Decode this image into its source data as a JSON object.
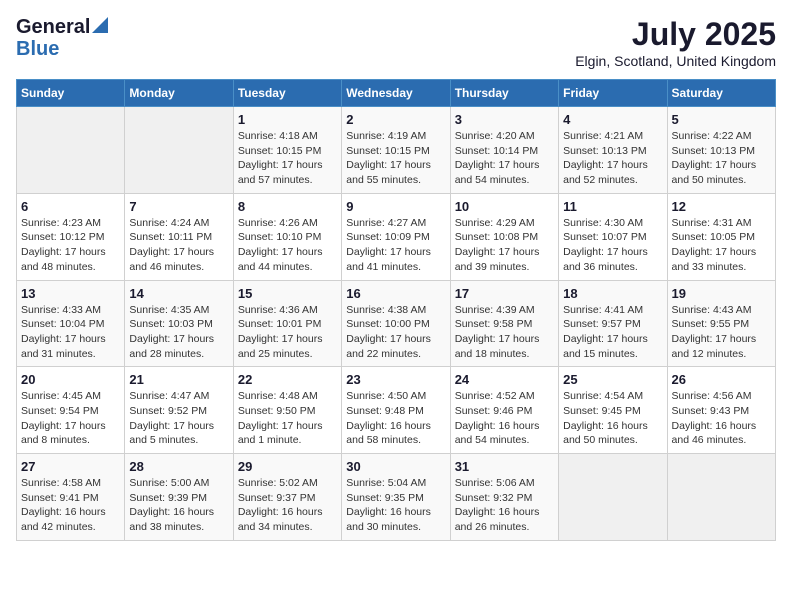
{
  "logo": {
    "general": "General",
    "blue": "Blue"
  },
  "title": "July 2025",
  "subtitle": "Elgin, Scotland, United Kingdom",
  "days_of_week": [
    "Sunday",
    "Monday",
    "Tuesday",
    "Wednesday",
    "Thursday",
    "Friday",
    "Saturday"
  ],
  "weeks": [
    [
      {
        "day": "",
        "info": ""
      },
      {
        "day": "",
        "info": ""
      },
      {
        "day": "1",
        "info": "Sunrise: 4:18 AM\nSunset: 10:15 PM\nDaylight: 17 hours and 57 minutes."
      },
      {
        "day": "2",
        "info": "Sunrise: 4:19 AM\nSunset: 10:15 PM\nDaylight: 17 hours and 55 minutes."
      },
      {
        "day": "3",
        "info": "Sunrise: 4:20 AM\nSunset: 10:14 PM\nDaylight: 17 hours and 54 minutes."
      },
      {
        "day": "4",
        "info": "Sunrise: 4:21 AM\nSunset: 10:13 PM\nDaylight: 17 hours and 52 minutes."
      },
      {
        "day": "5",
        "info": "Sunrise: 4:22 AM\nSunset: 10:13 PM\nDaylight: 17 hours and 50 minutes."
      }
    ],
    [
      {
        "day": "6",
        "info": "Sunrise: 4:23 AM\nSunset: 10:12 PM\nDaylight: 17 hours and 48 minutes."
      },
      {
        "day": "7",
        "info": "Sunrise: 4:24 AM\nSunset: 10:11 PM\nDaylight: 17 hours and 46 minutes."
      },
      {
        "day": "8",
        "info": "Sunrise: 4:26 AM\nSunset: 10:10 PM\nDaylight: 17 hours and 44 minutes."
      },
      {
        "day": "9",
        "info": "Sunrise: 4:27 AM\nSunset: 10:09 PM\nDaylight: 17 hours and 41 minutes."
      },
      {
        "day": "10",
        "info": "Sunrise: 4:29 AM\nSunset: 10:08 PM\nDaylight: 17 hours and 39 minutes."
      },
      {
        "day": "11",
        "info": "Sunrise: 4:30 AM\nSunset: 10:07 PM\nDaylight: 17 hours and 36 minutes."
      },
      {
        "day": "12",
        "info": "Sunrise: 4:31 AM\nSunset: 10:05 PM\nDaylight: 17 hours and 33 minutes."
      }
    ],
    [
      {
        "day": "13",
        "info": "Sunrise: 4:33 AM\nSunset: 10:04 PM\nDaylight: 17 hours and 31 minutes."
      },
      {
        "day": "14",
        "info": "Sunrise: 4:35 AM\nSunset: 10:03 PM\nDaylight: 17 hours and 28 minutes."
      },
      {
        "day": "15",
        "info": "Sunrise: 4:36 AM\nSunset: 10:01 PM\nDaylight: 17 hours and 25 minutes."
      },
      {
        "day": "16",
        "info": "Sunrise: 4:38 AM\nSunset: 10:00 PM\nDaylight: 17 hours and 22 minutes."
      },
      {
        "day": "17",
        "info": "Sunrise: 4:39 AM\nSunset: 9:58 PM\nDaylight: 17 hours and 18 minutes."
      },
      {
        "day": "18",
        "info": "Sunrise: 4:41 AM\nSunset: 9:57 PM\nDaylight: 17 hours and 15 minutes."
      },
      {
        "day": "19",
        "info": "Sunrise: 4:43 AM\nSunset: 9:55 PM\nDaylight: 17 hours and 12 minutes."
      }
    ],
    [
      {
        "day": "20",
        "info": "Sunrise: 4:45 AM\nSunset: 9:54 PM\nDaylight: 17 hours and 8 minutes."
      },
      {
        "day": "21",
        "info": "Sunrise: 4:47 AM\nSunset: 9:52 PM\nDaylight: 17 hours and 5 minutes."
      },
      {
        "day": "22",
        "info": "Sunrise: 4:48 AM\nSunset: 9:50 PM\nDaylight: 17 hours and 1 minute."
      },
      {
        "day": "23",
        "info": "Sunrise: 4:50 AM\nSunset: 9:48 PM\nDaylight: 16 hours and 58 minutes."
      },
      {
        "day": "24",
        "info": "Sunrise: 4:52 AM\nSunset: 9:46 PM\nDaylight: 16 hours and 54 minutes."
      },
      {
        "day": "25",
        "info": "Sunrise: 4:54 AM\nSunset: 9:45 PM\nDaylight: 16 hours and 50 minutes."
      },
      {
        "day": "26",
        "info": "Sunrise: 4:56 AM\nSunset: 9:43 PM\nDaylight: 16 hours and 46 minutes."
      }
    ],
    [
      {
        "day": "27",
        "info": "Sunrise: 4:58 AM\nSunset: 9:41 PM\nDaylight: 16 hours and 42 minutes."
      },
      {
        "day": "28",
        "info": "Sunrise: 5:00 AM\nSunset: 9:39 PM\nDaylight: 16 hours and 38 minutes."
      },
      {
        "day": "29",
        "info": "Sunrise: 5:02 AM\nSunset: 9:37 PM\nDaylight: 16 hours and 34 minutes."
      },
      {
        "day": "30",
        "info": "Sunrise: 5:04 AM\nSunset: 9:35 PM\nDaylight: 16 hours and 30 minutes."
      },
      {
        "day": "31",
        "info": "Sunrise: 5:06 AM\nSunset: 9:32 PM\nDaylight: 16 hours and 26 minutes."
      },
      {
        "day": "",
        "info": ""
      },
      {
        "day": "",
        "info": ""
      }
    ]
  ]
}
